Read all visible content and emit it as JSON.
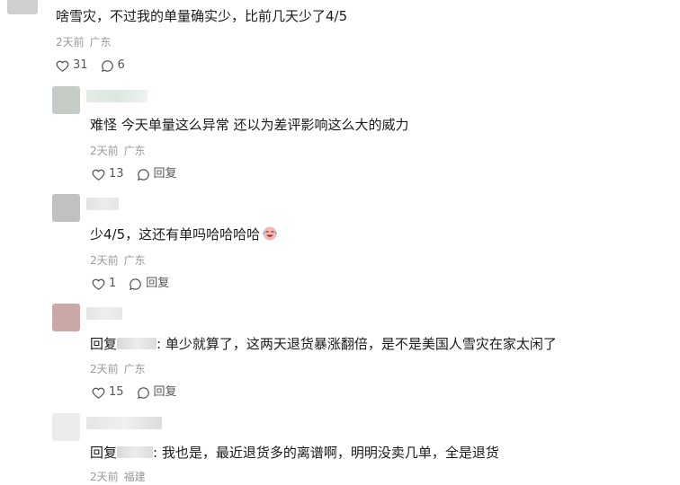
{
  "comments": [
    {
      "text": "啥雪灾，不过我的单量确实少，比前几天少了4/5",
      "time": "2天前",
      "location": "广东",
      "likes": "31",
      "replies": "6"
    },
    {
      "text": "难怪 今天单量这么异常 还以为差评影响这么大的威力",
      "time": "2天前",
      "location": "广东",
      "likes": "13",
      "reply_label": "回复"
    },
    {
      "text": "少4/5，这还有单吗哈哈哈哈",
      "time": "2天前",
      "location": "广东",
      "likes": "1",
      "reply_label": "回复"
    },
    {
      "reply_prefix": "回复",
      "text": ": 单少就算了，这两天退货暴涨翻倍，是不是美国人雪灾在家太闲了",
      "time": "2天前",
      "location": "广东",
      "likes": "15",
      "reply_label": "回复"
    },
    {
      "reply_prefix": "回复",
      "text": ": 我也是，最近退货多的离谱啊，明明没卖几单，全是退货",
      "time": "2天前",
      "location": "福建"
    }
  ],
  "colors": {
    "text": "#1a1a1a",
    "meta": "#9a9a9a"
  },
  "icons": {
    "like": "heart-outline-icon",
    "comment": "speech-bubble-icon",
    "emoji": "laughing-crying-emoji"
  }
}
